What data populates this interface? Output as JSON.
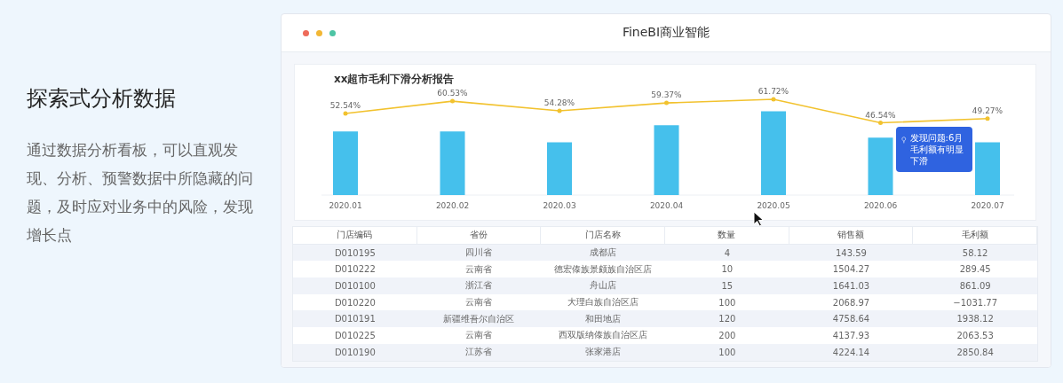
{
  "intro": {
    "heading": "探索式分析数据",
    "body": "通过数据分析看板，可以直观发现、分析、预警数据中所隐藏的问题，及时应对业务中的风险，发现增长点"
  },
  "window": {
    "title": "FineBI商业智能"
  },
  "report": {
    "title": "xx超市毛利下滑分析报告",
    "chart_data": {
      "type": "bar",
      "categories": [
        "2020.01",
        "2020.02",
        "2020.03",
        "2020.04",
        "2020.05",
        "2020.06",
        "2020.07"
      ],
      "series": [
        {
          "type": "bar",
          "color": "#45c0ec",
          "values": [
            41,
            41,
            34,
            45,
            54,
            37,
            34
          ]
        },
        {
          "type": "line",
          "color": "#f2c22e",
          "values": [
            52.54,
            60.53,
            54.28,
            59.37,
            61.72,
            46.54,
            49.27
          ],
          "value_labels": [
            "52.54%",
            "60.53%",
            "54.28%",
            "59.37%",
            "61.72%",
            "46.54%",
            "49.27%"
          ]
        }
      ]
    },
    "tooltip": {
      "text": "发现问题:6月毛利额有明显下滑"
    }
  },
  "table": {
    "columns": [
      "门店编码",
      "省份",
      "门店名称",
      "数量",
      "销售额",
      "毛利额"
    ],
    "rows": [
      [
        "D010195",
        "四川省",
        "成都店",
        "4",
        "143.59",
        "58.12"
      ],
      [
        "D010222",
        "云南省",
        "德宏傣族景颇族自治区店",
        "10",
        "1504.27",
        "289.45"
      ],
      [
        "D010100",
        "浙江省",
        "舟山店",
        "15",
        "1641.03",
        "861.09"
      ],
      [
        "D010220",
        "云南省",
        "大理白族自治区店",
        "100",
        "2068.97",
        "−1031.77"
      ],
      [
        "D010191",
        "新疆维吾尔自治区",
        "和田地店",
        "120",
        "4758.64",
        "1938.12"
      ],
      [
        "D010225",
        "云南省",
        "西双版纳傣族自治区店",
        "200",
        "4137.93",
        "2063.53"
      ],
      [
        "D010190",
        "江苏省",
        "张家港店",
        "100",
        "4224.14",
        "2850.84"
      ]
    ]
  }
}
